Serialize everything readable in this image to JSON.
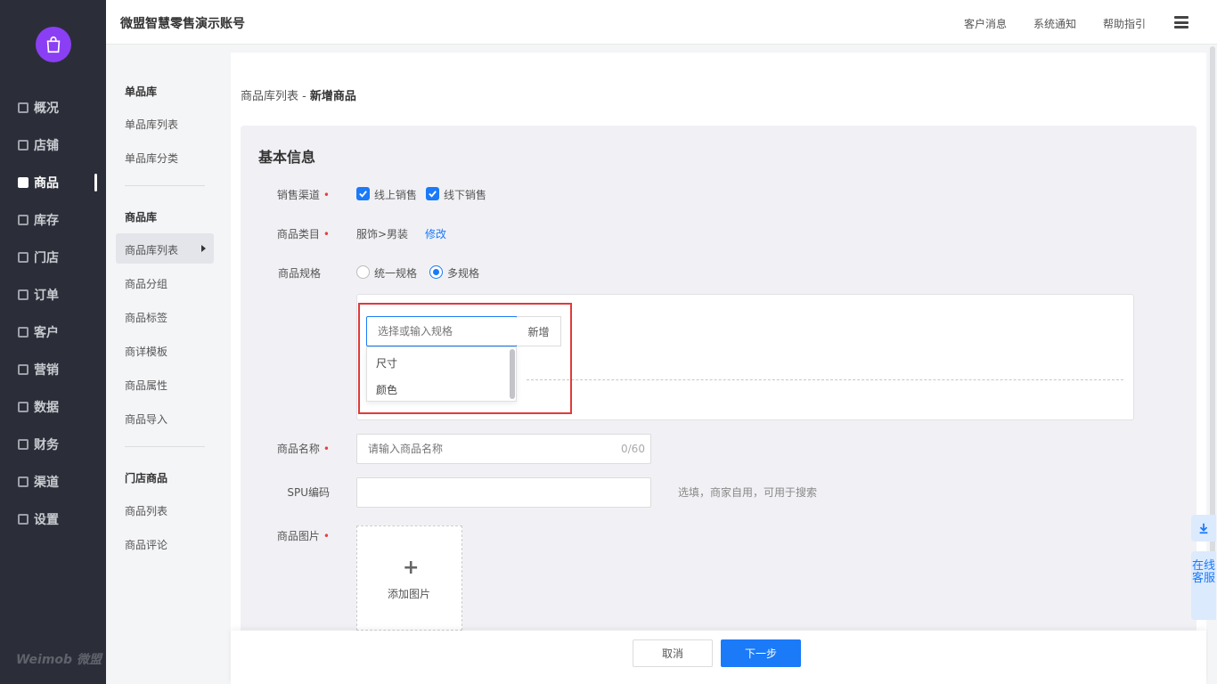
{
  "nav": {
    "items": [
      {
        "label": "概况",
        "icon": "overview-icon"
      },
      {
        "label": "店铺",
        "icon": "store-icon"
      },
      {
        "label": "商品",
        "icon": "goods-icon"
      },
      {
        "label": "库存",
        "icon": "inventory-icon"
      },
      {
        "label": "门店",
        "icon": "shop-icon"
      },
      {
        "label": "订单",
        "icon": "order-icon"
      },
      {
        "label": "客户",
        "icon": "customer-icon"
      },
      {
        "label": "营销",
        "icon": "marketing-icon"
      },
      {
        "label": "数据",
        "icon": "data-icon"
      },
      {
        "label": "财务",
        "icon": "finance-icon"
      },
      {
        "label": "渠道",
        "icon": "channel-icon"
      },
      {
        "label": "设置",
        "icon": "settings-icon"
      }
    ],
    "active": "商品",
    "brand": "Weimob 微盟"
  },
  "header": {
    "title": "微盟智慧零售演示账号",
    "links": [
      "客户消息",
      "系统通知",
      "帮助指引"
    ]
  },
  "subnav": {
    "group1": "单品库",
    "group1_items": [
      "单品库列表",
      "单品库分类"
    ],
    "group2": "商品库",
    "group2_items": [
      "商品库列表",
      "商品分组",
      "商品标签",
      "商详模板",
      "商品属性",
      "商品导入"
    ],
    "group3": "门店商品",
    "group3_items": [
      "商品列表",
      "商品评论"
    ]
  },
  "breadcrumb": {
    "parent": "商品库列表 -",
    "current": "新增商品"
  },
  "form": {
    "section_title": "基本信息",
    "channel_label": "销售渠道",
    "channel_online": "线上销售",
    "channel_offline": "线下销售",
    "category_label": "商品类目",
    "category_value": "服饰>男装",
    "category_edit": "修改",
    "spec_label": "商品规格",
    "spec_unified": "统一规格",
    "spec_multi": "多规格",
    "spec_input_placeholder": "选择或输入规格",
    "spec_add": "新增",
    "spec_options": [
      "尺寸",
      "颜色"
    ],
    "name_label": "商品名称",
    "name_placeholder": "请输入商品名称",
    "name_counter": "0/60",
    "spu_label": "SPU编码",
    "spu_hint": "选填，商家自用，可用于搜索",
    "image_label": "商品图片",
    "image_add": "添加图片",
    "required_mark": "•"
  },
  "footer": {
    "cancel": "取消",
    "next": "下一步"
  },
  "float": {
    "customer_service": "在线客服"
  },
  "colors": {
    "accent": "#1a7af8",
    "sidebar": "#2b2e38",
    "brand": "#8a3ff5",
    "highlight": "#e03a3a"
  }
}
